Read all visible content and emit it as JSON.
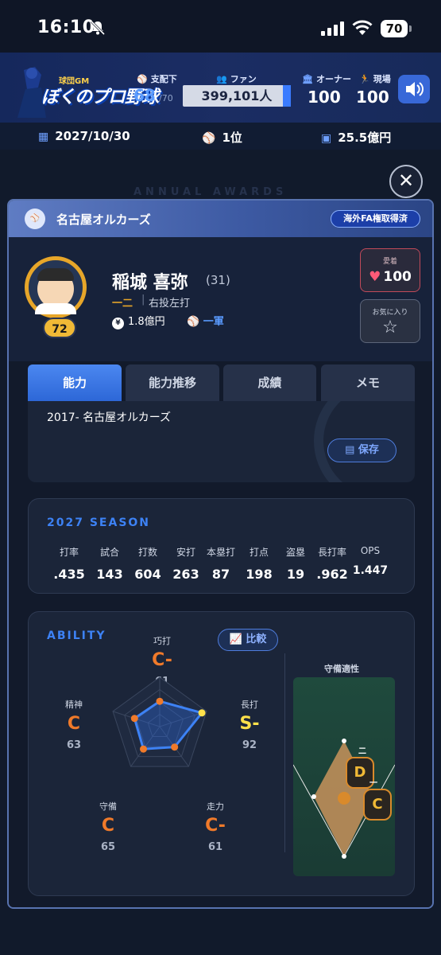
{
  "status": {
    "time": "16:10",
    "battery": "70"
  },
  "header": {
    "logo_sub": "球団GM",
    "logo_main": "ぼくのプロ野球",
    "dominion_label": "支配下",
    "dominion_value": "68",
    "dominion_max": "/70",
    "fans_label": "ファン",
    "fans_value": "399,101人",
    "owner_label": "オーナー",
    "owner_value": "100",
    "field_label": "現場",
    "field_value": "100",
    "date": "2027/10/30",
    "rank": "1位",
    "money": "25.5億円"
  },
  "background": {
    "awards_text": "ANNUAL AWARDS"
  },
  "modal": {
    "team": "名古屋オルカーズ",
    "fa_badge": "海外FA権取得済",
    "player": {
      "name": "稲城 喜弥",
      "age": "(31)",
      "position": "一二",
      "hand": "右投左打",
      "salary": "1.8億円",
      "team_level": "一軍",
      "overall": "72"
    },
    "love": {
      "label": "愛着",
      "value": "100"
    },
    "favorite": {
      "label": "お気に入り"
    },
    "tabs": [
      "能力",
      "能力推移",
      "成績",
      "メモ"
    ],
    "history": "2017- 名古屋オルカーズ",
    "save_label": "保存",
    "season": {
      "title": "2027 SEASON",
      "stats": [
        {
          "label": "打率",
          "value": ".435"
        },
        {
          "label": "試合",
          "value": "143"
        },
        {
          "label": "打数",
          "value": "604"
        },
        {
          "label": "安打",
          "value": "263"
        },
        {
          "label": "本塁打",
          "value": "87"
        },
        {
          "label": "打点",
          "value": "198"
        },
        {
          "label": "盗塁",
          "value": "19"
        },
        {
          "label": "長打率",
          "value": ".962"
        },
        {
          "label": "OPS",
          "value": "1.447"
        }
      ]
    },
    "ability": {
      "title": "ABILITY",
      "compare_label": "比較",
      "items": [
        {
          "label": "巧打",
          "grade": "C-",
          "value": "61"
        },
        {
          "label": "長打",
          "grade": "S-",
          "value": "92"
        },
        {
          "label": "走力",
          "grade": "C-",
          "value": "61"
        },
        {
          "label": "守備",
          "grade": "C",
          "value": "65"
        },
        {
          "label": "精神",
          "grade": "C",
          "value": "63"
        }
      ],
      "defense_title": "守備適性",
      "defense": [
        {
          "grade": "D",
          "mark": "二"
        },
        {
          "grade": "C",
          "mark": "一"
        }
      ]
    }
  },
  "colors": {
    "accent": "#3d82f5",
    "grade_c": "#f07a2a",
    "grade_s": "#ffe14a",
    "gold": "#e7a629"
  }
}
